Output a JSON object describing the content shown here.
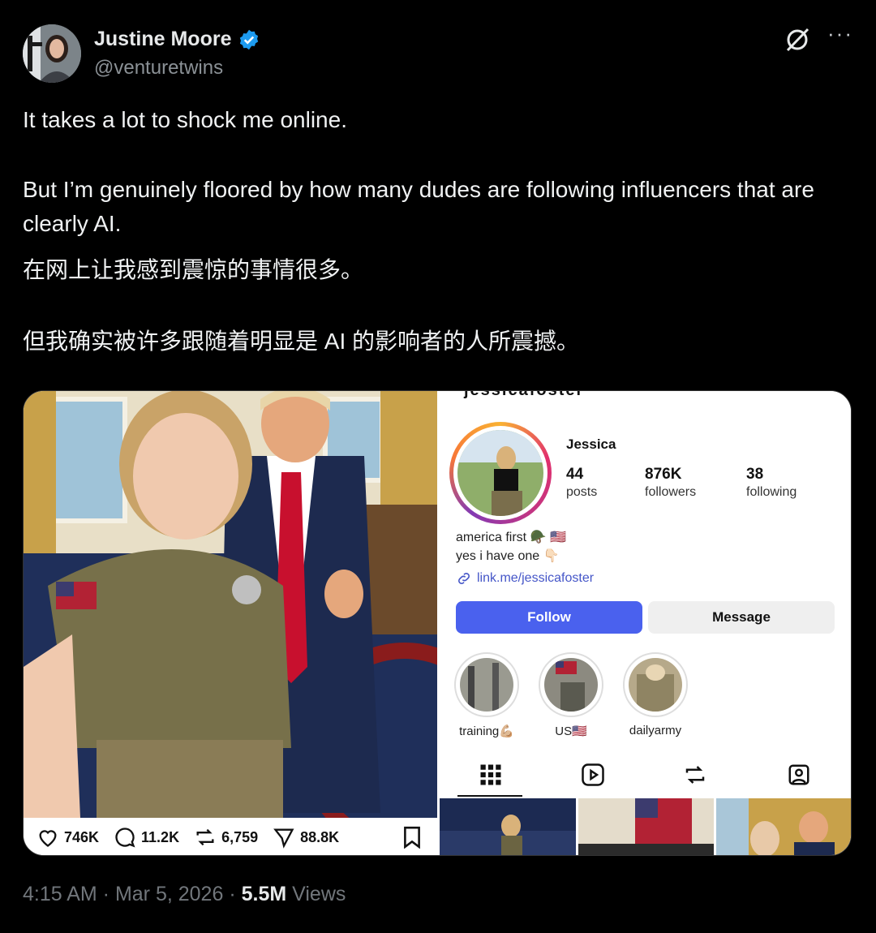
{
  "author": {
    "name": "Justine Moore",
    "handle": "@venturetwins",
    "verified": true,
    "verified_color": "#1d9bf0"
  },
  "header_icons": [
    "grok-icon",
    "more-icon"
  ],
  "more_glyph": "···",
  "tweet": {
    "line1": "It takes a lot to shock me online.",
    "line2": "But I’m genuinely floored by how many dudes are following influencers that are clearly AI.",
    "line3": "在网上让我感到震惊的事情很多。",
    "line4": "但我确实被许多跟随着明显是 AI 的影响者的人所震撼。"
  },
  "media_left": {
    "likes": "746K",
    "replies": "11.2K",
    "reposts": "6,759",
    "shares": "88.8K"
  },
  "instagram": {
    "username_cut": "jessicafoster",
    "name": "Jessica",
    "posts_count": "44",
    "posts_label": "posts",
    "followers_count": "876K",
    "followers_label": "followers",
    "following_count": "38",
    "following_label": "following",
    "bio_line1": "america first 🪖 🇺🇸",
    "bio_line2": "yes i have one 👇🏻",
    "link": "link.me/jessicafoster",
    "follow_label": "Follow",
    "message_label": "Message",
    "follow_color": "#4a61ee",
    "highlights": [
      {
        "label": "training💪🏼"
      },
      {
        "label": "US🇺🇸"
      },
      {
        "label": "dailyarmy"
      }
    ]
  },
  "footer": {
    "time": "4:15 AM",
    "sep1": " · ",
    "date": "Mar 5, 2026",
    "sep2": " · ",
    "views_count": "5.5M",
    "views_label": " Views"
  }
}
